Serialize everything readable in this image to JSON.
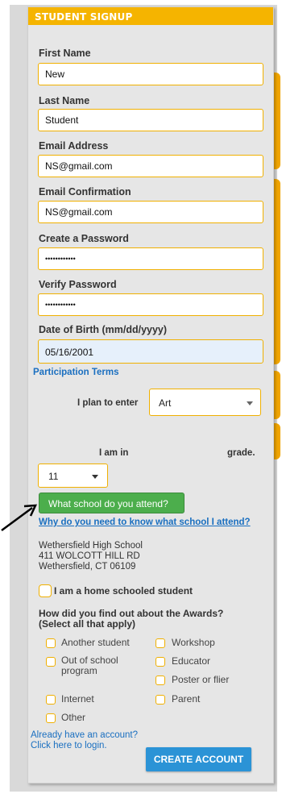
{
  "header": {
    "title": "STUDENT SIGNUP"
  },
  "fields": {
    "first_name": {
      "label": "First Name",
      "value": "New"
    },
    "last_name": {
      "label": "Last Name",
      "value": "Student"
    },
    "email": {
      "label": "Email Address",
      "value": "NS@gmail.com"
    },
    "email_confirm": {
      "label": "Email Confirmation",
      "value": "NS@gmail.com"
    },
    "password": {
      "label": "Create a Password",
      "value": "••••••••••••"
    },
    "verify_password": {
      "label": "Verify Password",
      "value": "••••••••••••"
    },
    "dob": {
      "label": "Date of Birth (mm/dd/yyyy)",
      "value": "05/16/2001"
    }
  },
  "participation_terms": "Participation Terms",
  "plan": {
    "label": "I plan to enter",
    "selected": "Art"
  },
  "grade": {
    "label_left": "I am in",
    "label_right": "grade.",
    "selected": "11"
  },
  "school": {
    "button": "What school do you attend?",
    "why_link": "Why do you need to know what school I attend?",
    "name": "Wethersfield High School",
    "address": "411 WOLCOTT HILL RD",
    "city": "Wethersfield, CT 06109"
  },
  "home_schooled": "I am a home schooled student",
  "found_out": {
    "question": "How did you find out about the Awards? (Select all that apply)",
    "options": [
      "Another student",
      "Workshop",
      "Out of school program",
      "Educator",
      "Poster or flier",
      "Internet",
      "Parent",
      "Other"
    ]
  },
  "login": {
    "line1": "Already have an account?",
    "line2": "Click here to login."
  },
  "create_button": "CREATE ACCOUNT",
  "colors": {
    "accent": "#f5b400",
    "green": "#4cae4c",
    "blue": "#2b93d6",
    "link": "#1a6fc0"
  }
}
